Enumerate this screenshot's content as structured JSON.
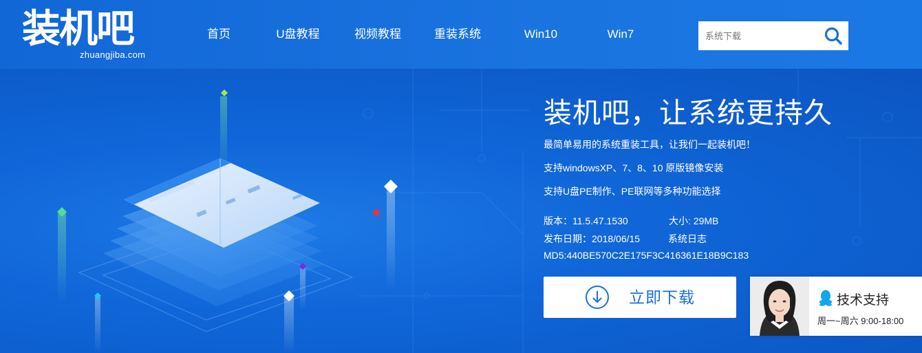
{
  "header": {
    "logo_cn": "装机吧",
    "logo_en": "zhuangjiba.com",
    "nav": [
      {
        "label": "首页"
      },
      {
        "label": "U盘教程"
      },
      {
        "label": "视频教程"
      },
      {
        "label": "重装系统"
      },
      {
        "label": "Win10"
      },
      {
        "label": "Win7"
      }
    ],
    "search": {
      "placeholder": "系统下载",
      "icon": "search-icon"
    }
  },
  "hero": {
    "title": "装机吧，让系统更持久",
    "features": [
      "最简单易用的系统重装工具，让我们一起装机吧！",
      "支持windowsXP、7、8、10 原版镜像安装",
      "支持U盘PE制作、PE联网等多种功能选择"
    ],
    "version": "版本：11.5.47.1530",
    "size": "大小: 29MB",
    "release_date": "发布日期：2018/06/15",
    "changelog": "系统日志",
    "md5": "MD5:440BE570C2E175F3C416361E18B9C183",
    "download_label": "立即下载",
    "support": {
      "title": "技术支持",
      "hours": "周一~周六 9:00-18:00"
    }
  },
  "colors": {
    "brand_blue": "#1a6fde",
    "header_bg": "#1a74e0",
    "hero_bg": "#0f62d2"
  }
}
